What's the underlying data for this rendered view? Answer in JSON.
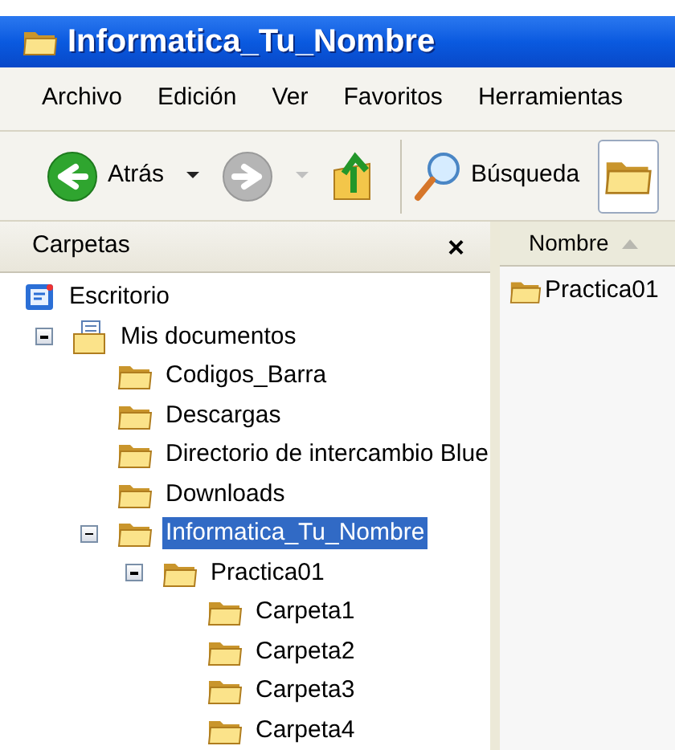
{
  "window": {
    "title": "Informatica_Tu_Nombre"
  },
  "menu": [
    "Archivo",
    "Edición",
    "Ver",
    "Favoritos",
    "Herramientas"
  ],
  "toolbar": [
    {
      "kind": "back",
      "label": "Atrás",
      "disabled": false
    },
    {
      "kind": "forward",
      "disabled": true
    },
    {
      "kind": "up"
    },
    {
      "kind": "search",
      "label": "Búsqueda"
    },
    {
      "kind": "folders",
      "selected": true
    }
  ],
  "folders_pane": {
    "title": "Carpetas",
    "close": "×"
  },
  "tree": [
    {
      "kind": "desktop",
      "label": "Escritorio",
      "selected": false,
      "children": [
        {
          "kind": "documents",
          "label": "Mis documentos",
          "selected": false,
          "expanded": true,
          "children": [
            {
              "kind": "folder",
              "label": "Codigos_Barra",
              "selected": false
            },
            {
              "kind": "folder",
              "label": "Descargas",
              "selected": false
            },
            {
              "kind": "folder",
              "label": "Directorio de intercambio Blue",
              "selected": false
            },
            {
              "kind": "folder",
              "label": "Downloads",
              "selected": false
            },
            {
              "kind": "folder",
              "label": "Informatica_Tu_Nombre",
              "selected": true,
              "expanded": true,
              "children": [
                {
                  "kind": "folder",
                  "label": "Practica01",
                  "selected": false,
                  "expanded": true,
                  "children": [
                    {
                      "kind": "folder",
                      "label": "Carpeta1",
                      "selected": false
                    },
                    {
                      "kind": "folder",
                      "label": "Carpeta2",
                      "selected": false
                    },
                    {
                      "kind": "folder",
                      "label": "Carpeta3",
                      "selected": false
                    },
                    {
                      "kind": "folder",
                      "label": "Carpeta4",
                      "selected": false
                    }
                  ]
                }
              ]
            }
          ]
        }
      ]
    }
  ],
  "file_list": {
    "columns": [
      {
        "label": "Nombre",
        "sorted": true
      }
    ],
    "items": [
      {
        "name": "Practica01"
      }
    ]
  }
}
